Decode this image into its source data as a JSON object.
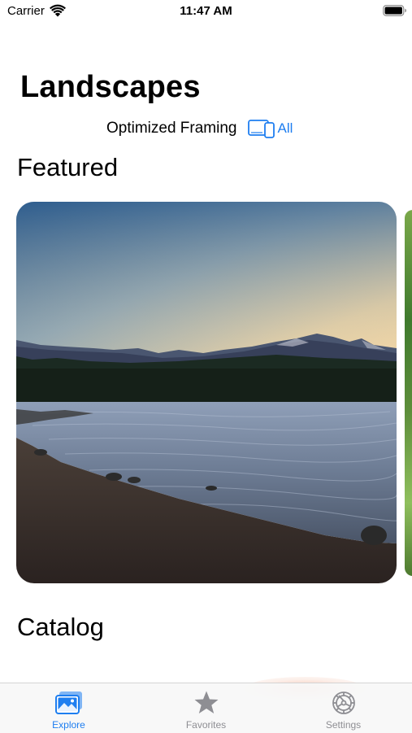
{
  "status_bar": {
    "carrier": "Carrier",
    "time": "11:47 AM"
  },
  "page": {
    "title": "Landscapes"
  },
  "framing": {
    "label": "Optimized Framing",
    "value": "All",
    "icon": "devices-icon"
  },
  "sections": {
    "featured": "Featured",
    "catalog": "Catalog"
  },
  "featured_card": {
    "image_subject": "mountain lake at dusk"
  },
  "tab_bar": {
    "tabs": [
      {
        "label": "Explore",
        "icon": "photos-icon",
        "selected": true
      },
      {
        "label": "Favorites",
        "icon": "star-icon",
        "selected": false
      },
      {
        "label": "Settings",
        "icon": "gear-icon",
        "selected": false
      }
    ]
  },
  "colors": {
    "accent": "#1e7ef0",
    "inactive": "#8e8e93"
  }
}
